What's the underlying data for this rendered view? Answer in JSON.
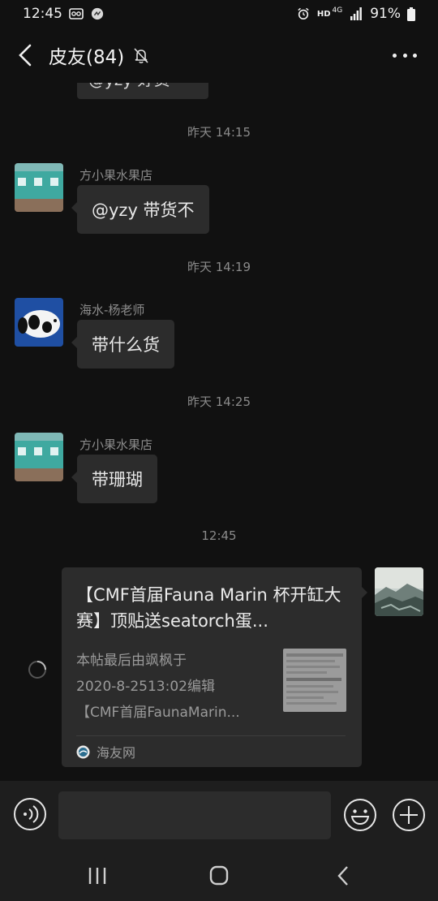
{
  "status_bar": {
    "time": "12:45",
    "network": "HD",
    "network_gen": "4G",
    "battery": "91%"
  },
  "header": {
    "title": "皮友(84)"
  },
  "cut_message": {
    "text": "@yzy 好货"
  },
  "messages": [
    {
      "timestamp": "昨天 14:15",
      "sender": "方小果水果店",
      "avatar": "shop-avatar",
      "text": "@yzy  带货不"
    },
    {
      "timestamp": "昨天 14:19",
      "sender": "海水-杨老师",
      "avatar": "fish-avatar",
      "text": "带什么货"
    },
    {
      "timestamp": "昨天 14:25",
      "sender": "方小果水果店",
      "avatar": "shop-avatar",
      "text": "带珊瑚"
    }
  ],
  "shared_link": {
    "timestamp": "12:45",
    "title": "【CMF首届Fauna Marin 杯开缸大赛】顶贴送seatorch蛋...",
    "desc_line1": "本帖最后由飒枫于",
    "desc_line2": "2020-8-2513:02编辑",
    "desc_line3": "【CMF首届FaunaMarin...",
    "source": "海友网",
    "status": "sending"
  },
  "input": {
    "value": ""
  },
  "colors": {
    "background": "#111111",
    "bubble": "#2c2c2c",
    "bar": "#1e1e1e",
    "shop_teal": "#3fa9a0"
  }
}
